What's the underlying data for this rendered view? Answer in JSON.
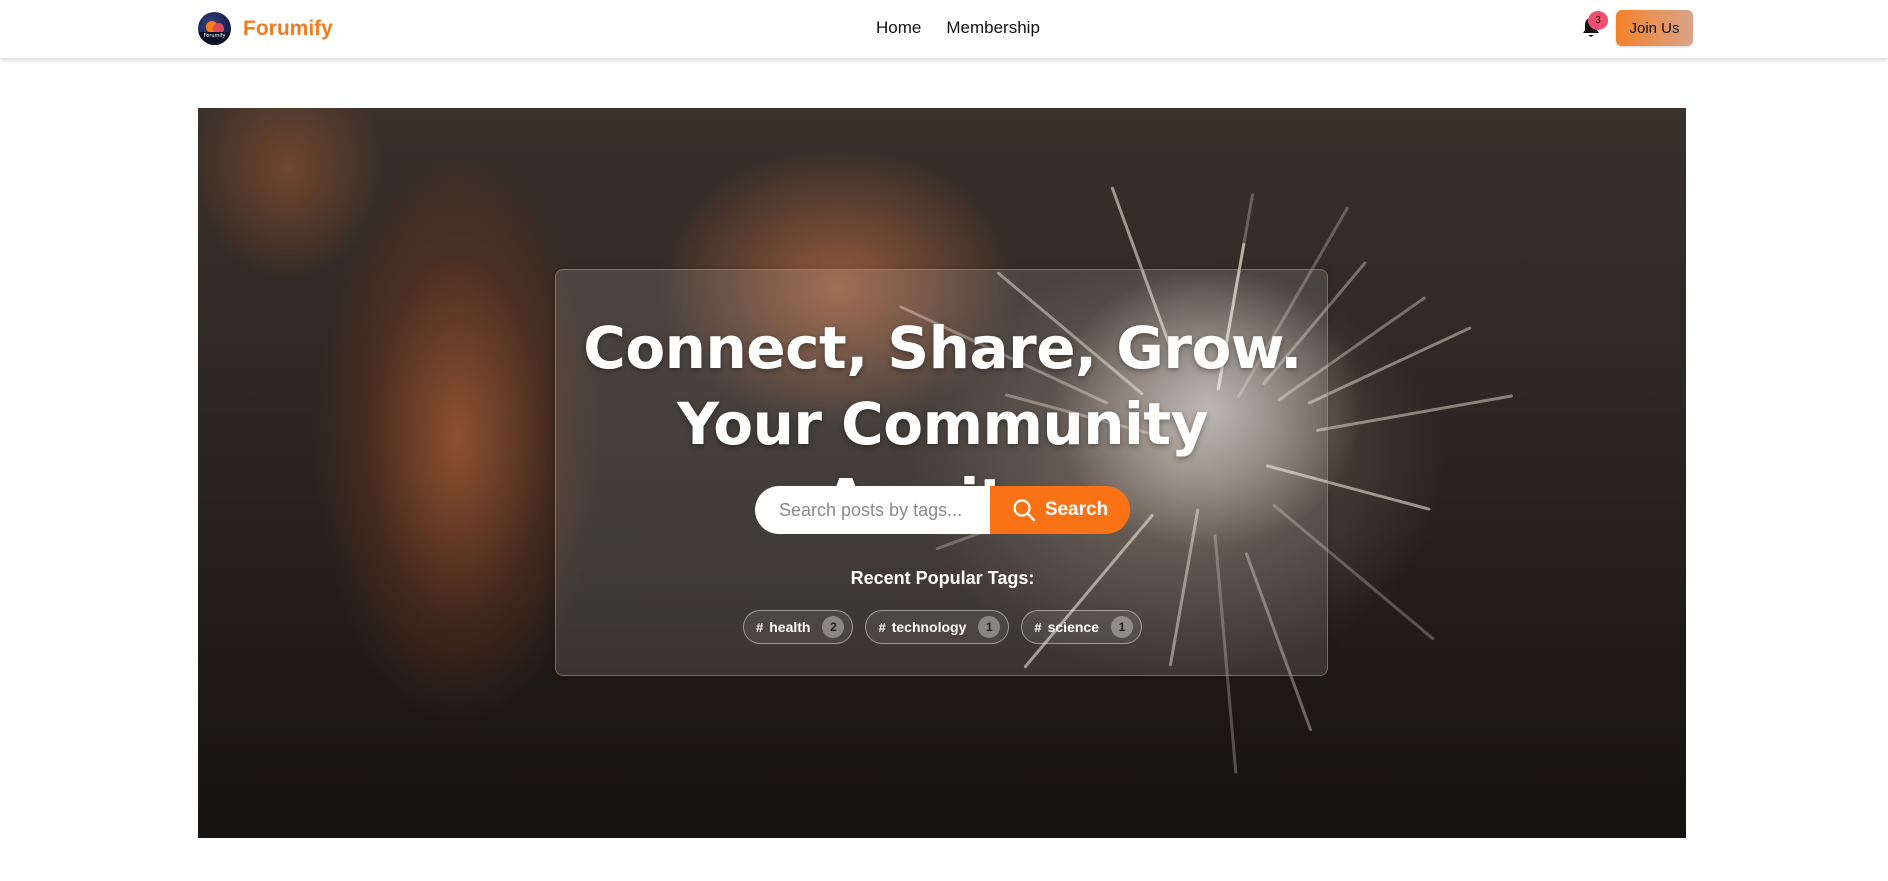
{
  "brand": {
    "name": "Forumify",
    "logo_text": "Forumify"
  },
  "nav": {
    "links": [
      "Home",
      "Membership"
    ]
  },
  "notifications": {
    "count": "3"
  },
  "header": {
    "join_label": "Join Us"
  },
  "hero": {
    "headline_line1": "Connect, Share, Grow.",
    "headline_line2": "Your Community Awaits.",
    "search": {
      "placeholder": "Search posts by tags...",
      "button_label": "Search"
    },
    "tags_title": "Recent Popular Tags:",
    "tags": [
      {
        "name": "health",
        "count": "2"
      },
      {
        "name": "technology",
        "count": "1"
      },
      {
        "name": "science",
        "count": "1"
      }
    ]
  },
  "colors": {
    "accent": "#f97316",
    "brand": "#f47b20",
    "badge": "#f0506e"
  },
  "icons": {
    "bell": "bell-icon",
    "search": "search-icon"
  }
}
